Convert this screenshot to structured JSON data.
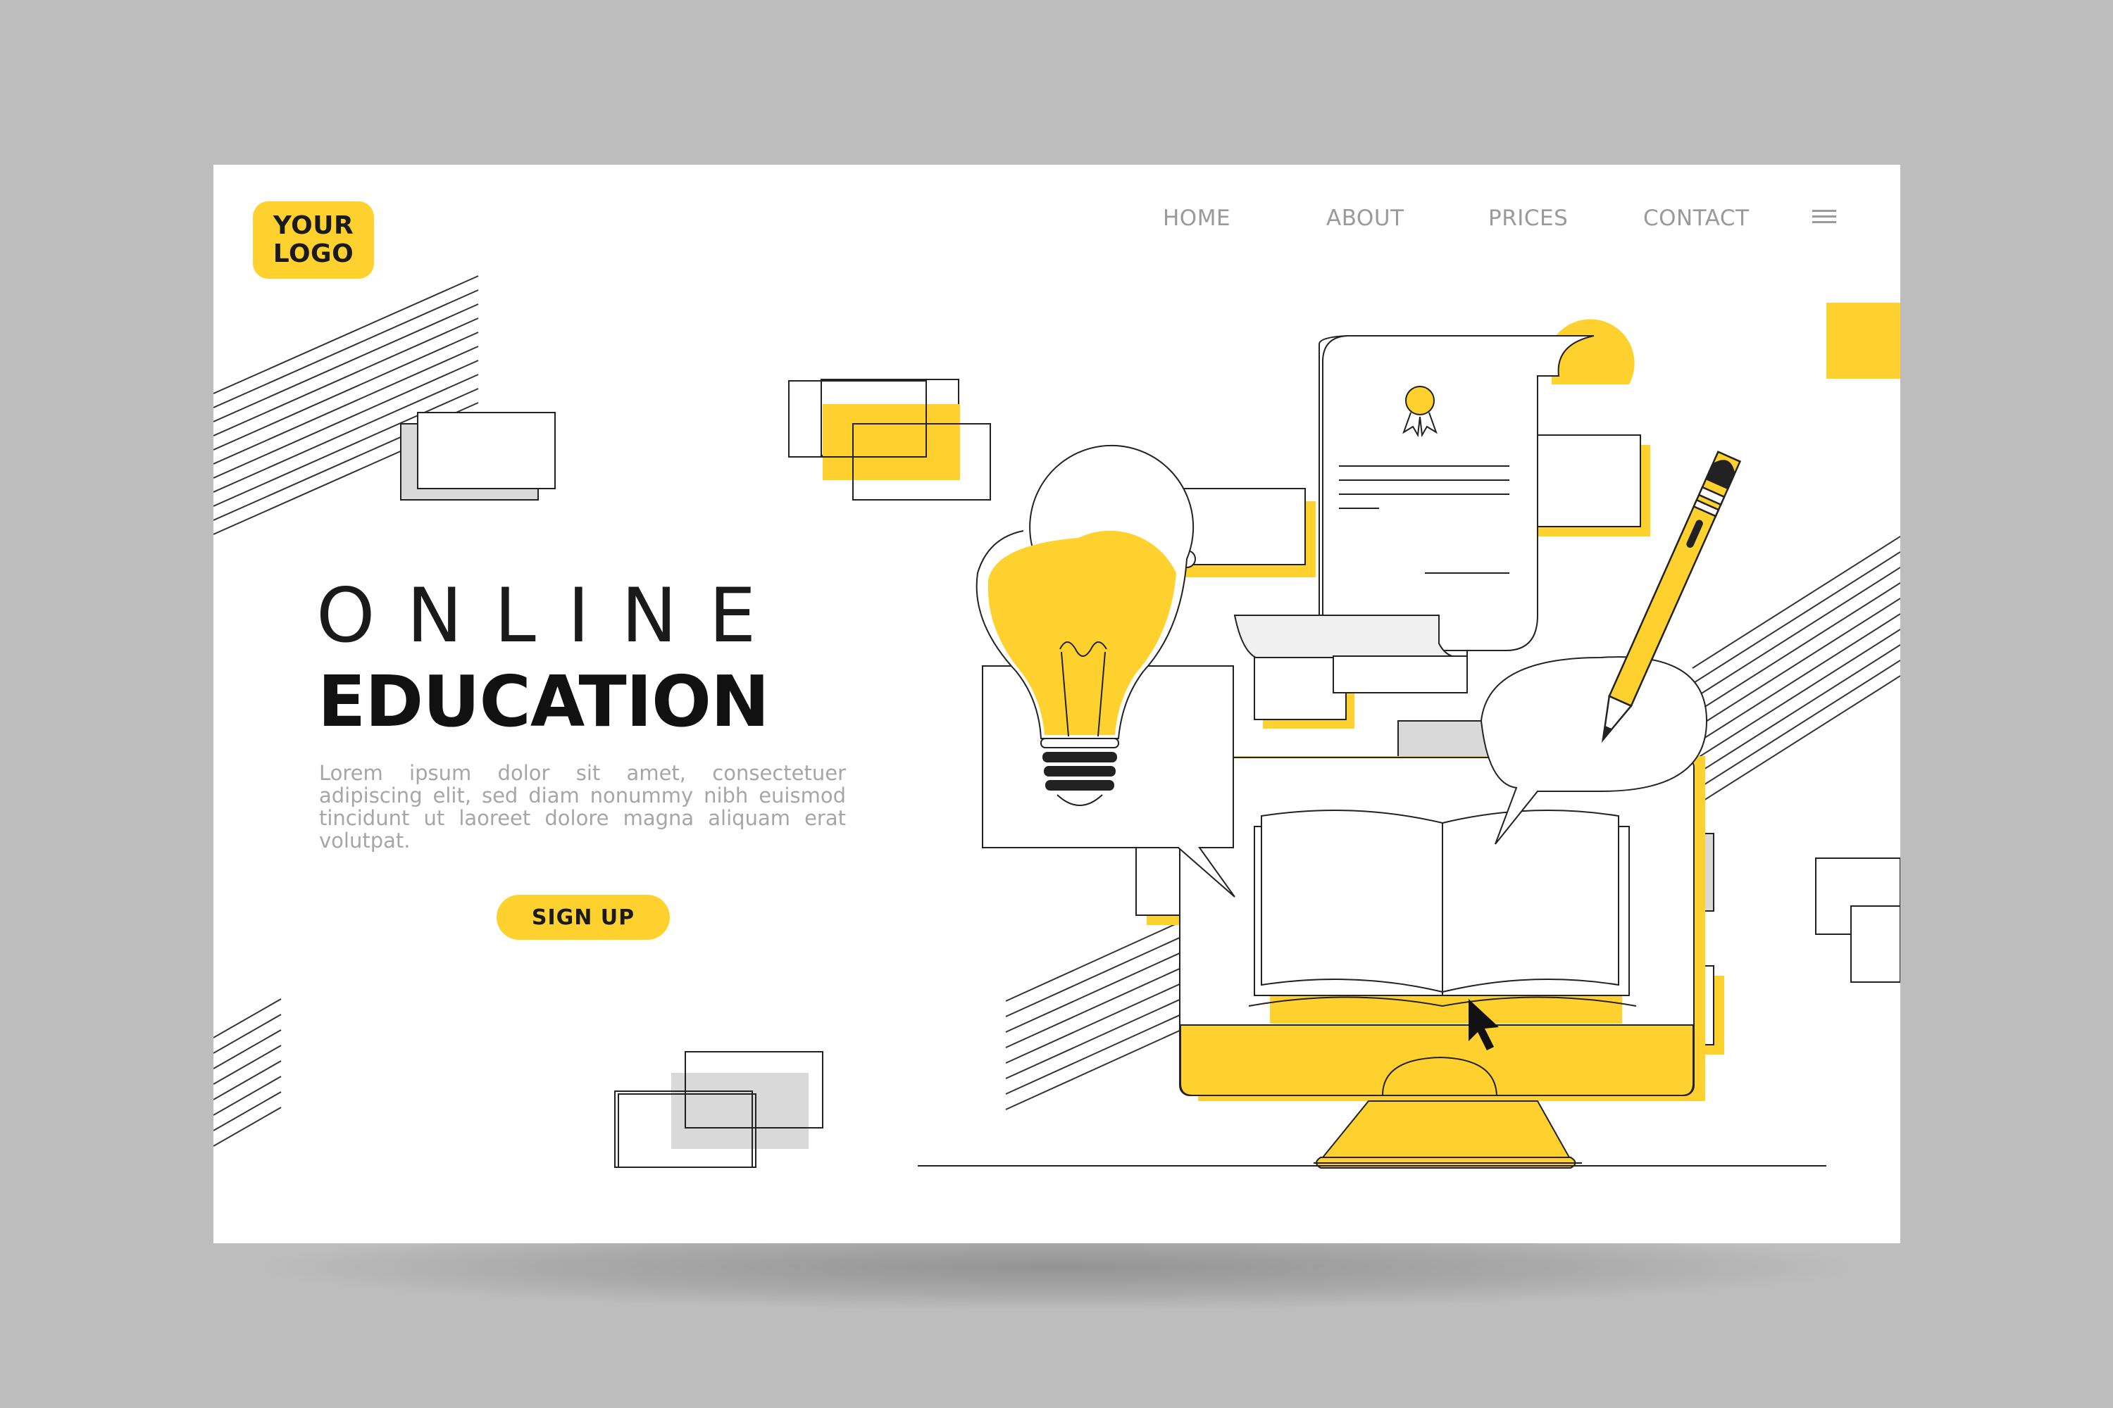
{
  "logo": {
    "line1": "YOUR",
    "line2": "LOGO"
  },
  "nav": {
    "items": [
      {
        "label": "HOME"
      },
      {
        "label": "ABOUT"
      },
      {
        "label": "PRICES"
      },
      {
        "label": "CONTACT"
      }
    ],
    "menu_icon": "hamburger-menu-icon"
  },
  "hero": {
    "title_line1": "ONLINE",
    "title_line2": "EDUCATION",
    "description": "Lorem ipsum dolor sit amet, consectetuer adipiscing elit, sed diam nonummy nibh euismod tincidunt ut laoreet dolore magna aliquam erat volutpat.",
    "cta_label": "SIGN UP"
  },
  "illustration": {
    "icons": [
      "certificate-icon",
      "lightbulb-icon",
      "pencil-icon",
      "open-book-icon",
      "monitor-icon",
      "cursor-icon",
      "speech-bubble-icon"
    ]
  },
  "colors": {
    "accent": "#ffd12f",
    "outer_background": "#bdbdbd",
    "page_background": "#ffffff",
    "text_dark": "#1a1a1a",
    "text_muted": "#a6a6a6",
    "line": "#222222",
    "gray_fill": "#d9d9d9"
  }
}
